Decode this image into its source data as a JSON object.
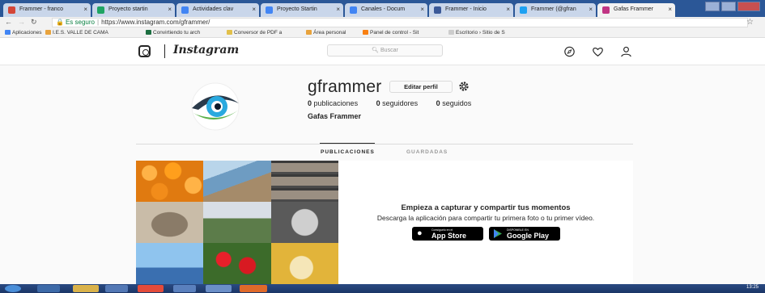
{
  "browser": {
    "tabs": [
      {
        "label": "Frammer - franco",
        "color": "#d44638"
      },
      {
        "label": "Proyecto startin",
        "color": "#1fa463"
      },
      {
        "label": "Actividades clav",
        "color": "#4285f4"
      },
      {
        "label": "Proyecto Startin",
        "color": "#4285f4"
      },
      {
        "label": "Canales - Docum",
        "color": "#4285f4"
      },
      {
        "label": "Frammer - Inicio",
        "color": "#3b5998"
      },
      {
        "label": "Frammer (@gfran",
        "color": "#1da1f2"
      },
      {
        "label": "Gafas Frammer",
        "color": "#c13584"
      }
    ],
    "secure_label": "Es seguro",
    "url": "https://www.instagram.com/gframmer/",
    "bookmarks": [
      "Aplicaciones",
      "I.E.S. VALLE DE CAMA",
      "Convirtiendo tu arch",
      "Conversor de PDF a",
      "Área personal",
      "Panel de control - Sit",
      "Escritorio › Sitio de S"
    ]
  },
  "instagram": {
    "wordmark": "Instagram",
    "search_placeholder": "Buscar",
    "profile": {
      "username": "gframmer",
      "edit_label": "Editar perfil",
      "posts": "0",
      "posts_label": "publicaciones",
      "followers": "0",
      "followers_label": "seguidores",
      "following": "0",
      "following_label": "seguidos",
      "full_name": "Gafas Frammer"
    },
    "tabs": [
      "PUBLICACIONES",
      "GUARDADAS"
    ],
    "empty_state": {
      "title": "Empieza a capturar y compartir tus momentos",
      "subtitle": "Descarga la aplicación para compartir tu primera foto o tu primer vídeo."
    },
    "app_store": {
      "small": "Consíguelo en el",
      "big": "App Store"
    },
    "google_play": {
      "small": "DISPONIBLE EN",
      "big": "Google Play"
    }
  },
  "taskbar": {
    "clock": "13:25"
  },
  "colors": {
    "ig_blue": "#3897f0",
    "text": "#262626",
    "border": "#dbdbdb"
  }
}
